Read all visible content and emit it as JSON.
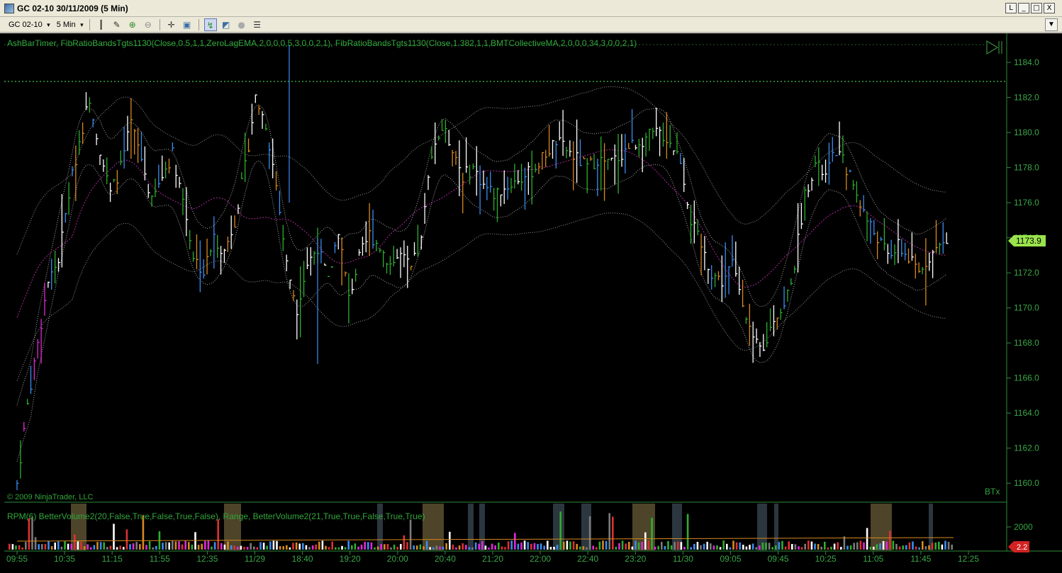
{
  "window": {
    "title": "GC 02-10  30/11/2009 (5 Min)",
    "buttons": [
      "L",
      "_",
      "□",
      "X"
    ]
  },
  "toolbar": {
    "instrument": "GC 02-10",
    "period": "5 Min",
    "icons": [
      "bar-style-icon",
      "drawing-pencil-icon",
      "zoom-in-icon",
      "zoom-out-icon",
      "crosshair-icon",
      "properties-icon",
      "indicators-icon",
      "strategies-icon",
      "globe-icon",
      "data-box-icon"
    ]
  },
  "indicator_label": "AshBarTimer, FibRatioBandsTgts1130(Close,0.5,1,1,ZeroLagEMA,2,0,0,0,5,3,0,0,2,1), FibRatioBandsTgts1130(Close,1.382,1,1,BMTCollectiveMA,2,0,0,0,34,3,0,0,2,1)",
  "copyright": "© 2009 NinjaTrader, LLC",
  "watermark": "BTx",
  "lower_panel_label": "RPM(6)   BetterVolume2(20,False,True,False,True,False),  Range,   BetterVolume2(21,True,True,False,True,True)",
  "lower_value_label": "2000",
  "lower_badge": "2.2",
  "price_badge": "1173.9",
  "colors": {
    "background": "#000000",
    "axis_green": "#2f8a3a",
    "label_green": "#32a63c",
    "price_badge_bg": "#9ae34c",
    "lower_badge_bg": "#d22222",
    "bar_white": "#ffffff",
    "bar_green": "#2fae2f",
    "bar_blue": "#3b8df0",
    "bar_orange": "#d8891e",
    "bar_magenta": "#e02ad8",
    "band_gray": "#bdbdbd",
    "ma_magenta": "#b02aa0"
  },
  "chart_data": {
    "type": "candlestick",
    "ylim": [
      1159,
      1185.5
    ],
    "y_ticks": [
      1160.0,
      1162.0,
      1164.0,
      1166.0,
      1168.0,
      1170.0,
      1172.0,
      1174.0,
      1176.0,
      1178.0,
      1180.0,
      1182.0,
      1184.0
    ],
    "y_tick_labels": [
      "1160.0",
      "1162.0",
      "1164.0",
      "1166.0",
      "1168.0",
      "1170.0",
      "1172.0",
      "1174.0",
      "1176.0",
      "1178.0",
      "1180.0",
      "1182.0",
      "1184.0"
    ],
    "x_tick_labels": [
      "09:55",
      "10:35",
      "11:15",
      "11:55",
      "12:35",
      "11/29",
      "18:40",
      "19:20",
      "20:00",
      "20:40",
      "21:20",
      "22:00",
      "22:40",
      "23:20",
      "11/30",
      "09:05",
      "09:45",
      "10:25",
      "11:05",
      "11:45",
      "12:25"
    ],
    "last_price": 1173.9,
    "close_path": [
      1160.0,
      1164.5,
      1168.0,
      1171.5,
      1172.8,
      1176.5,
      1179.5,
      1182.0,
      1179.0,
      1176.5,
      1178.0,
      1180.5,
      1178.5,
      1176.0,
      1177.5,
      1178.8,
      1176.2,
      1173.0,
      1172.0,
      1174.0,
      1173.2,
      1175.0,
      1178.0,
      1182.0,
      1180.5,
      1177.0,
      1172.5,
      1170.0,
      1172.5,
      1173.5,
      1171.5,
      1174.5,
      1170.5,
      1172.8,
      1174.2,
      1173.5,
      1172.5,
      1173.0,
      1172.2,
      1173.8,
      1179.0,
      1180.2,
      1179.2,
      1177.5,
      1178.0,
      1177.0,
      1176.5,
      1176.8,
      1177.2,
      1177.5,
      1178.0,
      1178.8,
      1179.5,
      1179.0,
      1178.5,
      1178.0,
      1178.5,
      1178.2,
      1178.6,
      1179.2,
      1179.5,
      1179.8,
      1180.0,
      1179.5,
      1178.5,
      1175.0,
      1173.5,
      1172.0,
      1171.5,
      1172.5,
      1170.5,
      1168.0,
      1167.5,
      1169.5,
      1170.0,
      1172.5,
      1176.5,
      1178.2,
      1177.5,
      1179.0,
      1178.0,
      1176.5,
      1175.0,
      1174.0,
      1173.0,
      1173.5,
      1172.8,
      1172.0,
      1173.0,
      1173.5,
      1173.9
    ],
    "volume_level": 2000,
    "lower_value": 2.2
  }
}
